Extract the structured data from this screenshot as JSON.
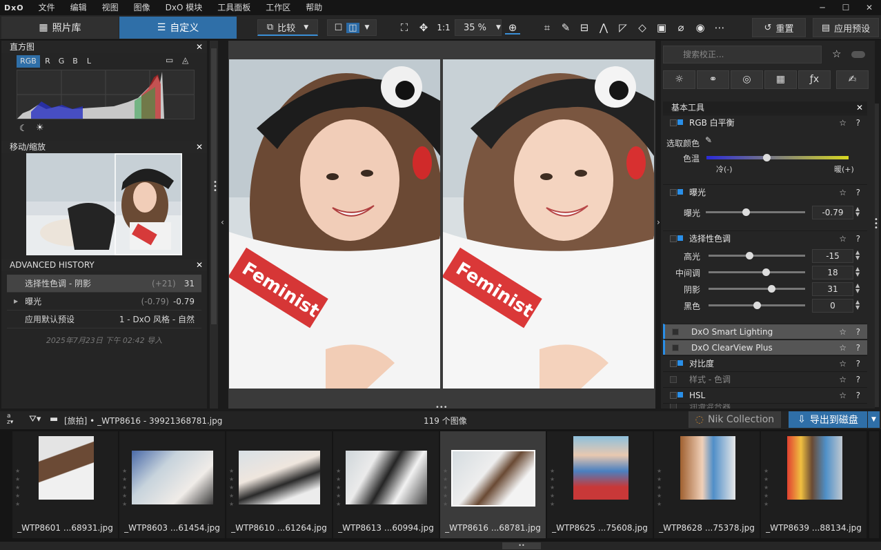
{
  "menubar": {
    "logo": "DxO",
    "items": [
      "文件",
      "编辑",
      "视图",
      "图像",
      "DxO 模块",
      "工具面板",
      "工作区",
      "帮助"
    ]
  },
  "toolbar": {
    "tab_library": "照片库",
    "tab_customize": "自定义",
    "compare": "比较",
    "one_to_one": "1:1",
    "zoom": "35 %",
    "reset": "重置",
    "apply_preset": "应用预设"
  },
  "left": {
    "histogram": {
      "title": "直方图",
      "channels": [
        "RGB",
        "R",
        "G",
        "B",
        "L"
      ]
    },
    "navigator": {
      "title": "移动/缩放"
    },
    "history": {
      "title": "ADVANCED HISTORY",
      "rows": [
        {
          "label": "选择性色调 - 阴影",
          "prev": "(+21)",
          "value": "31"
        },
        {
          "label": "曝光",
          "prev": "(-0.79)",
          "value": "-0.79"
        },
        {
          "label": "应用默认预设",
          "prev": "",
          "value": "1 - DxO 风格 - 自然"
        }
      ],
      "imported": "2025年7月23日 下午 02:42 导入"
    }
  },
  "right": {
    "search_placeholder": "搜索校正...",
    "section": "基本工具",
    "white_balance": {
      "title": "RGB 白平衡",
      "picker": "选取颜色",
      "temp": "色温",
      "cold": "冷(-)",
      "warm": "暖(+)",
      "level": 0.42
    },
    "exposure": {
      "title": "曝光",
      "label": "曝光",
      "value": "-0.79",
      "level": 0.4
    },
    "tone": {
      "title": "选择性色调",
      "rows": [
        {
          "label": "高光",
          "value": "-15",
          "level": 0.42
        },
        {
          "label": "中间调",
          "value": "18",
          "level": 0.59
        },
        {
          "label": "阴影",
          "value": "31",
          "level": 0.65
        },
        {
          "label": "黑色",
          "value": "0",
          "level": 0.5
        }
      ]
    },
    "tools": [
      "DxO Smart Lighting",
      "DxO ClearView Plus",
      "对比度",
      "样式 - 色调",
      "HSL",
      "润滑混合器"
    ]
  },
  "filmstrip": {
    "path": "[旅拍] • _WTP8616 - 39921368781.jpg",
    "count": "119 个图像",
    "nik": "Nik Collection",
    "export": "导出到磁盘",
    "items": [
      "_WTP8601 ...68931.jpg",
      "_WTP8603 ...61454.jpg",
      "_WTP8610 ...61264.jpg",
      "_WTP8613 ...60994.jpg",
      "_WTP8616 ...68781.jpg",
      "_WTP8625 ...75608.jpg",
      "_WTP8628 ...75378.jpg",
      "_WTP8639 ...88134.jpg"
    ]
  },
  "viewer": {
    "left_caption": "Feminist",
    "right_caption": "Feminist"
  },
  "colors": {
    "accent": "#2f6fa8",
    "checkbox": "#2a8fe8"
  }
}
